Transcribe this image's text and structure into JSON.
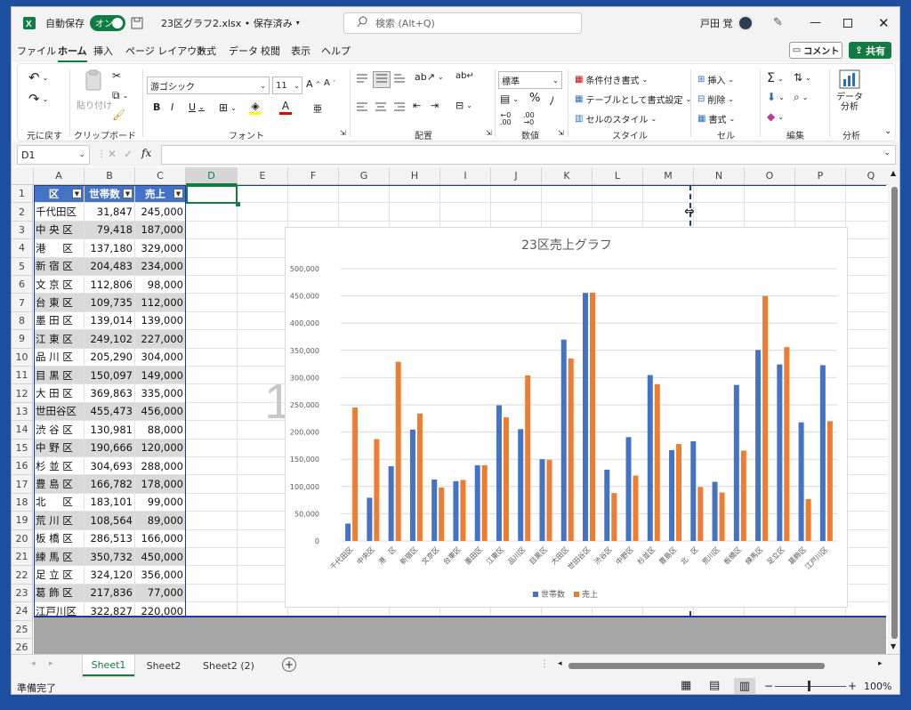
{
  "titlebar": {
    "autosave_label": "自動保存",
    "autosave_state": "オン",
    "filename": "23区グラフ2.xlsx • 保存済み",
    "search_placeholder": "検索 (Alt+Q)",
    "user": "戸田 覚"
  },
  "menu": {
    "tabs": [
      "ファイル",
      "ホーム",
      "挿入",
      "ページ レイアウト",
      "数式",
      "データ",
      "校閲",
      "表示",
      "ヘルプ"
    ],
    "active": 1,
    "comment": "コメント",
    "share": "共有"
  },
  "ribbon": {
    "undo": "元に戻す",
    "paste": "貼り付け",
    "clipboard": "クリップボード",
    "font_name": "游ゴシック",
    "font_size": "11",
    "font": "フォント",
    "alignment": "配置",
    "number_format": "標準",
    "number": "数値",
    "cond_format": "条件付き書式",
    "table_format": "テーブルとして書式設定",
    "cell_style": "セルのスタイル",
    "style": "スタイル",
    "insert": "挿入",
    "delete": "削除",
    "format": "書式",
    "cells": "セル",
    "edit": "編集",
    "analyze": "データ\n分析",
    "analysis": "分析"
  },
  "formula": {
    "namebox": "D1",
    "fx": "fx",
    "content": ""
  },
  "columns": [
    "A",
    "B",
    "C",
    "D",
    "E",
    "F",
    "G",
    "H",
    "I",
    "J",
    "K",
    "L",
    "M",
    "N",
    "O",
    "P",
    "Q"
  ],
  "rows": [
    "1",
    "2",
    "3",
    "4",
    "5",
    "6",
    "7",
    "8",
    "9",
    "10",
    "11",
    "12",
    "13",
    "14",
    "15",
    "16",
    "17",
    "18",
    "19",
    "20",
    "21",
    "22",
    "23",
    "24",
    "25",
    "26"
  ],
  "table": {
    "headers": [
      "区",
      "世帯数",
      "売上"
    ],
    "data": [
      [
        "千代田区",
        "31,847",
        "245,000"
      ],
      [
        "中 央 区",
        "79,418",
        "187,000"
      ],
      [
        "港 　 区",
        "137,180",
        "329,000"
      ],
      [
        "新 宿 区",
        "204,483",
        "234,000"
      ],
      [
        "文 京 区",
        "112,806",
        "98,000"
      ],
      [
        "台 東 区",
        "109,735",
        "112,000"
      ],
      [
        "墨 田 区",
        "139,014",
        "139,000"
      ],
      [
        "江 東 区",
        "249,102",
        "227,000"
      ],
      [
        "品 川 区",
        "205,290",
        "304,000"
      ],
      [
        "目 黒 区",
        "150,097",
        "149,000"
      ],
      [
        "大 田 区",
        "369,863",
        "335,000"
      ],
      [
        "世田谷区",
        "455,473",
        "456,000"
      ],
      [
        "渋 谷 区",
        "130,981",
        "88,000"
      ],
      [
        "中 野 区",
        "190,666",
        "120,000"
      ],
      [
        "杉 並 区",
        "304,693",
        "288,000"
      ],
      [
        "豊 島 区",
        "166,782",
        "178,000"
      ],
      [
        "北 　 区",
        "183,101",
        "99,000"
      ],
      [
        "荒 川 区",
        "108,564",
        "89,000"
      ],
      [
        "板 橋 区",
        "286,513",
        "166,000"
      ],
      [
        "練 馬 区",
        "350,732",
        "450,000"
      ],
      [
        "足 立 区",
        "324,120",
        "356,000"
      ],
      [
        "葛 飾 区",
        "217,836",
        "77,000"
      ],
      [
        "江戸川区",
        "322,827",
        "220,000"
      ]
    ]
  },
  "page_break_label": "1",
  "chart_data": {
    "type": "bar",
    "title": "23区売上グラフ",
    "categories": [
      "千代田区",
      "中央区",
      "港　区",
      "新宿区",
      "文京区",
      "台東区",
      "墨田区",
      "江東区",
      "品川区",
      "目黒区",
      "大田区",
      "世田谷区",
      "渋谷区",
      "中野区",
      "杉並区",
      "豊島区",
      "北　区",
      "荒川区",
      "板橋区",
      "練馬区",
      "足立区",
      "葛飾区",
      "江戸川区"
    ],
    "series": [
      {
        "name": "世帯数",
        "color": "#4472c4",
        "values": [
          31847,
          79418,
          137180,
          204483,
          112806,
          109735,
          139014,
          249102,
          205290,
          150097,
          369863,
          455473,
          130981,
          190666,
          304693,
          166782,
          183101,
          108564,
          286513,
          350732,
          324120,
          217836,
          322827
        ]
      },
      {
        "name": "売上",
        "color": "#ed7d31",
        "values": [
          245000,
          187000,
          329000,
          234000,
          98000,
          112000,
          139000,
          227000,
          304000,
          149000,
          335000,
          456000,
          88000,
          120000,
          288000,
          178000,
          99000,
          89000,
          166000,
          450000,
          356000,
          77000,
          220000
        ]
      }
    ],
    "ylim": [
      0,
      500000
    ],
    "yticks": [
      "500,000",
      "450,000",
      "400,000",
      "350,000",
      "300,000",
      "250,000",
      "200,000",
      "150,000",
      "100,000",
      "50,000",
      "0"
    ],
    "legend": "bottom",
    "grid": true
  },
  "tabs": [
    "Sheet1",
    "Sheet2",
    "Sheet2 (2)"
  ],
  "status": {
    "ready": "準備完了",
    "zoom": "100%"
  }
}
